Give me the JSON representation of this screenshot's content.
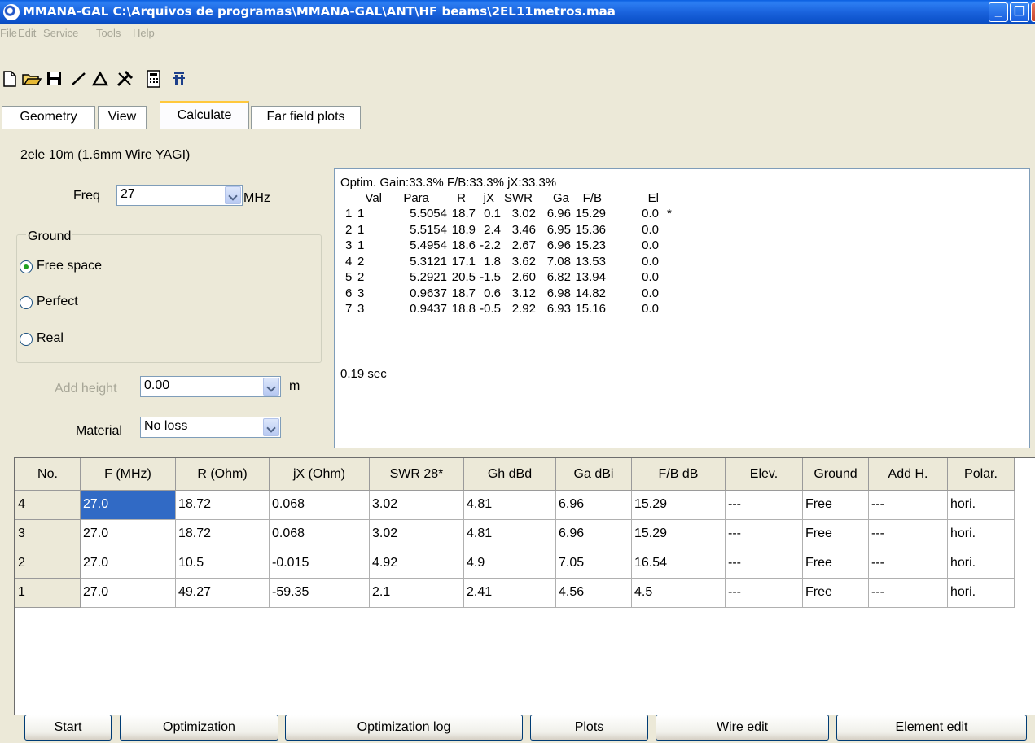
{
  "window": {
    "title": "MMANA-GAL C:\\Arquivos de programas\\MMANA-GAL\\ANT\\HF beams\\2EL11metros.maa"
  },
  "menu": [
    "File",
    "Edit",
    "Service",
    "Tools",
    "Help"
  ],
  "tabs": [
    "Geometry",
    "View",
    "Calculate",
    "Far field plots"
  ],
  "antenna_name": "2ele 10m  (1.6mm Wire YAGI)",
  "freq": {
    "label": "Freq",
    "value": "27",
    "unit": "MHz"
  },
  "ground": {
    "legend": "Ground",
    "options": [
      "Free space",
      "Perfect",
      "Real"
    ],
    "selected": "Free space"
  },
  "add_height": {
    "label": "Add height",
    "value": "0.00",
    "unit": "m"
  },
  "material": {
    "label": "Material",
    "value": "No loss"
  },
  "results": {
    "header": "Optim. Gain:33.3% F/B:33.3% jX:33.3%",
    "columns": [
      "Val",
      "Para",
      "R",
      "jX",
      "SWR",
      "Ga",
      "F/B",
      "El"
    ],
    "rows": [
      [
        "1",
        "1",
        "5.5054",
        "18.7",
        "0.1",
        "3.02",
        "6.96",
        "15.29",
        "0.0",
        "*"
      ],
      [
        "2",
        "1",
        "5.5154",
        "18.9",
        "2.4",
        "3.46",
        "6.95",
        "15.36",
        "0.0",
        ""
      ],
      [
        "3",
        "1",
        "5.4954",
        "18.6",
        "-2.2",
        "2.67",
        "6.96",
        "15.23",
        "0.0",
        ""
      ],
      [
        "4",
        "2",
        "5.3121",
        "17.1",
        "1.8",
        "3.62",
        "7.08",
        "13.53",
        "0.0",
        ""
      ],
      [
        "5",
        "2",
        "5.2921",
        "20.5",
        "-1.5",
        "2.60",
        "6.82",
        "13.94",
        "0.0",
        ""
      ],
      [
        "6",
        "3",
        "0.9637",
        "18.7",
        "0.6",
        "3.12",
        "6.98",
        "14.82",
        "0.0",
        ""
      ],
      [
        "7",
        "3",
        "0.9437",
        "18.8",
        "-0.5",
        "2.92",
        "6.93",
        "15.16",
        "0.0",
        ""
      ]
    ],
    "footer": "0.19 sec"
  },
  "grid": {
    "columns": [
      "No.",
      "F (MHz)",
      "R (Ohm)",
      "jX (Ohm)",
      "SWR 28*",
      "Gh dBd",
      "Ga dBi",
      "F/B dB",
      "Elev.",
      "Ground",
      "Add H.",
      "Polar."
    ],
    "rows": [
      [
        "4",
        "27.0",
        "18.72",
        "0.068",
        "3.02",
        "4.81",
        "6.96",
        "15.29",
        "---",
        "Free",
        "---",
        "hori."
      ],
      [
        "3",
        "27.0",
        "18.72",
        "0.068",
        "3.02",
        "4.81",
        "6.96",
        "15.29",
        "---",
        "Free",
        "---",
        "hori."
      ],
      [
        "2",
        "27.0",
        "10.5",
        "-0.015",
        "4.92",
        "4.9",
        "7.05",
        "16.54",
        "---",
        "Free",
        "---",
        "hori."
      ],
      [
        "1",
        "27.0",
        "49.27",
        "-59.35",
        "2.1",
        "2.41",
        "4.56",
        "4.5",
        "---",
        "Free",
        "---",
        "hori."
      ]
    ]
  },
  "buttons": [
    "Start",
    "Optimization",
    "Optimization log",
    "Plots",
    "Wire edit",
    "Element edit"
  ],
  "toolbar_icons": [
    "new-file-icon",
    "open-folder-icon",
    "save-icon",
    "wire-line-icon",
    "triangle-icon",
    "tools-icon",
    "calculator-icon",
    "antenna-tower-icon"
  ],
  "colors": {
    "titlebar": "#0b50c8",
    "selection": "#316ac5",
    "active_tab": "#ffc83c"
  }
}
